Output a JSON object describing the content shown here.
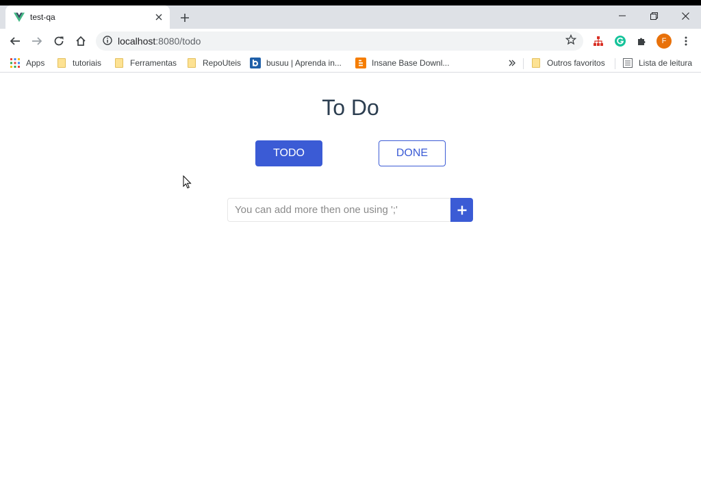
{
  "browser": {
    "tab_title": "test-qa",
    "url_host": "localhost",
    "url_rest": ":8080/todo",
    "profile_initial": "F"
  },
  "bookmarks": [
    {
      "label": "Apps",
      "icon": "apps-grid-icon"
    },
    {
      "label": "tutoriais",
      "icon": "folder-icon"
    },
    {
      "label": "Ferramentas",
      "icon": "folder-icon"
    },
    {
      "label": "RepoUteis",
      "icon": "folder-icon"
    },
    {
      "label": "busuu | Aprenda in...",
      "icon": "busuu-icon"
    },
    {
      "label": "Insane Base Downl...",
      "icon": "blogger-icon"
    },
    {
      "label": "Outros favoritos",
      "icon": "folder-icon"
    },
    {
      "label": "Lista de leitura",
      "icon": "reading-list-icon"
    }
  ],
  "page": {
    "title": "To Do",
    "tabs": {
      "todo_label": "TODO",
      "done_label": "DONE",
      "active": "TODO"
    },
    "add": {
      "placeholder": "You can add more then one using ';'",
      "value": ""
    }
  },
  "colors": {
    "accent": "#3b5bd5",
    "title": "#2c3e50"
  }
}
